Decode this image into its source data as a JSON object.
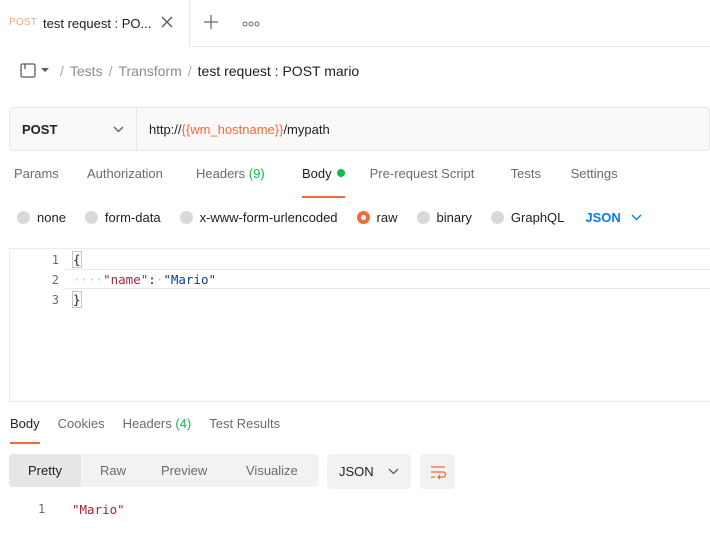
{
  "tab": {
    "method": "POST",
    "name": "test request : PO..."
  },
  "breadcrumb": {
    "items": [
      "Tests",
      "Transform"
    ],
    "current": "test request : POST mario",
    "separator": "/"
  },
  "request": {
    "method": "POST",
    "url_prefix": "http://",
    "url_variable": "{{wm_hostname}}",
    "url_suffix": "/mypath"
  },
  "request_tabs": {
    "params": "Params",
    "authorization": "Authorization",
    "headers": "Headers",
    "headers_count": "(9)",
    "body": "Body",
    "pre_request": "Pre-request Script",
    "tests": "Tests",
    "settings": "Settings"
  },
  "body_types": {
    "none": "none",
    "form_data": "form-data",
    "urlencoded": "x-www-form-urlencoded",
    "raw": "raw",
    "binary": "binary",
    "graphql": "GraphQL",
    "selected": "raw",
    "language": "JSON"
  },
  "editor": {
    "line_numbers": [
      "1",
      "2",
      "3"
    ],
    "open_brace": "{",
    "indent": "····",
    "key": "\"name\"",
    "colon": ":",
    "space": "·",
    "value": "\"Mario\"",
    "close_brace": "}"
  },
  "response_tabs": {
    "body": "Body",
    "cookies": "Cookies",
    "headers": "Headers",
    "headers_count": "(4)",
    "test_results": "Test Results"
  },
  "response_view": {
    "pretty": "Pretty",
    "raw": "Raw",
    "preview": "Preview",
    "visualize": "Visualize",
    "format": "JSON"
  },
  "response_body": {
    "line_number": "1",
    "text": "\"Mario\""
  },
  "colors": {
    "accent": "#f26b3a",
    "success": "#0cbb52",
    "link_blue": "#097bed"
  }
}
